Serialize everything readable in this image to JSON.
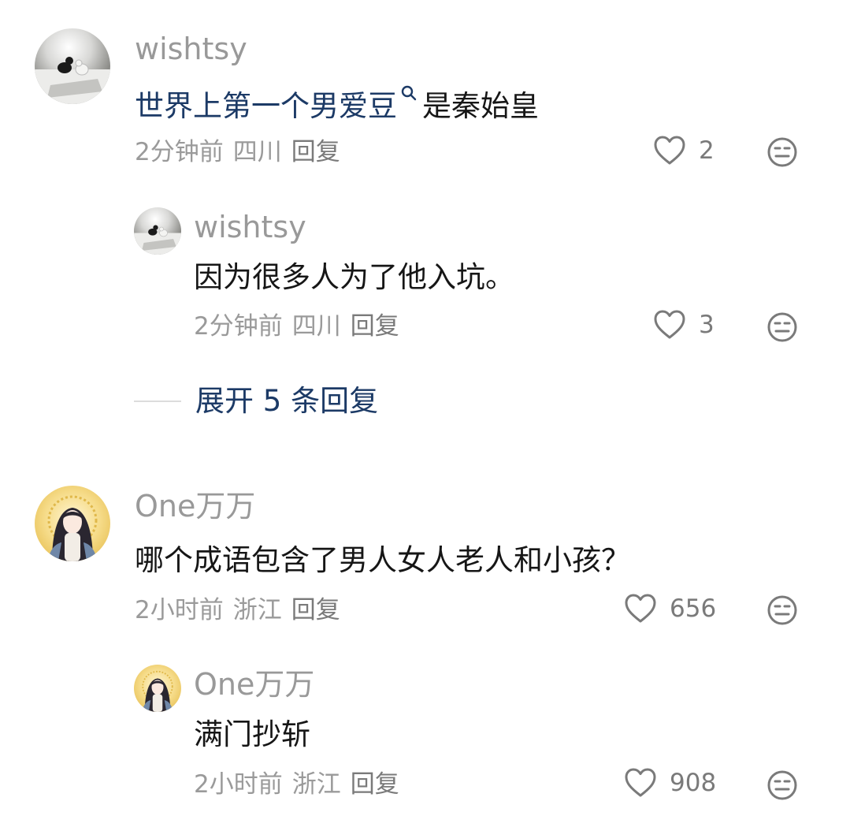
{
  "comments": [
    {
      "username": "wishtsy",
      "text_link": "世界上第一个男爱豆",
      "text_rest": "是秦始皇",
      "time": "2分钟前",
      "location": "四川",
      "reply_label": "回复",
      "likes": "2",
      "replies": [
        {
          "username": "wishtsy",
          "text": "因为很多人为了他入坑。",
          "time": "2分钟前",
          "location": "四川",
          "reply_label": "回复",
          "likes": "3"
        }
      ],
      "expand_label": "展开 5 条回复"
    },
    {
      "username": "One万万",
      "text": "哪个成语包含了男人女人老人和小孩？",
      "time": "2小时前",
      "location": "浙江",
      "reply_label": "回复",
      "likes": "656",
      "replies": [
        {
          "username": "One万万",
          "text": "满门抄斩",
          "time": "2小时前",
          "location": "浙江",
          "reply_label": "回复",
          "likes": "908"
        }
      ]
    }
  ],
  "icons": {
    "like": "heart-outline-icon",
    "dislike": "neutral-face-icon",
    "search": "search-icon"
  },
  "colors": {
    "link": "#1c3a66",
    "username": "#999999",
    "meta": "#9a9a9a"
  }
}
